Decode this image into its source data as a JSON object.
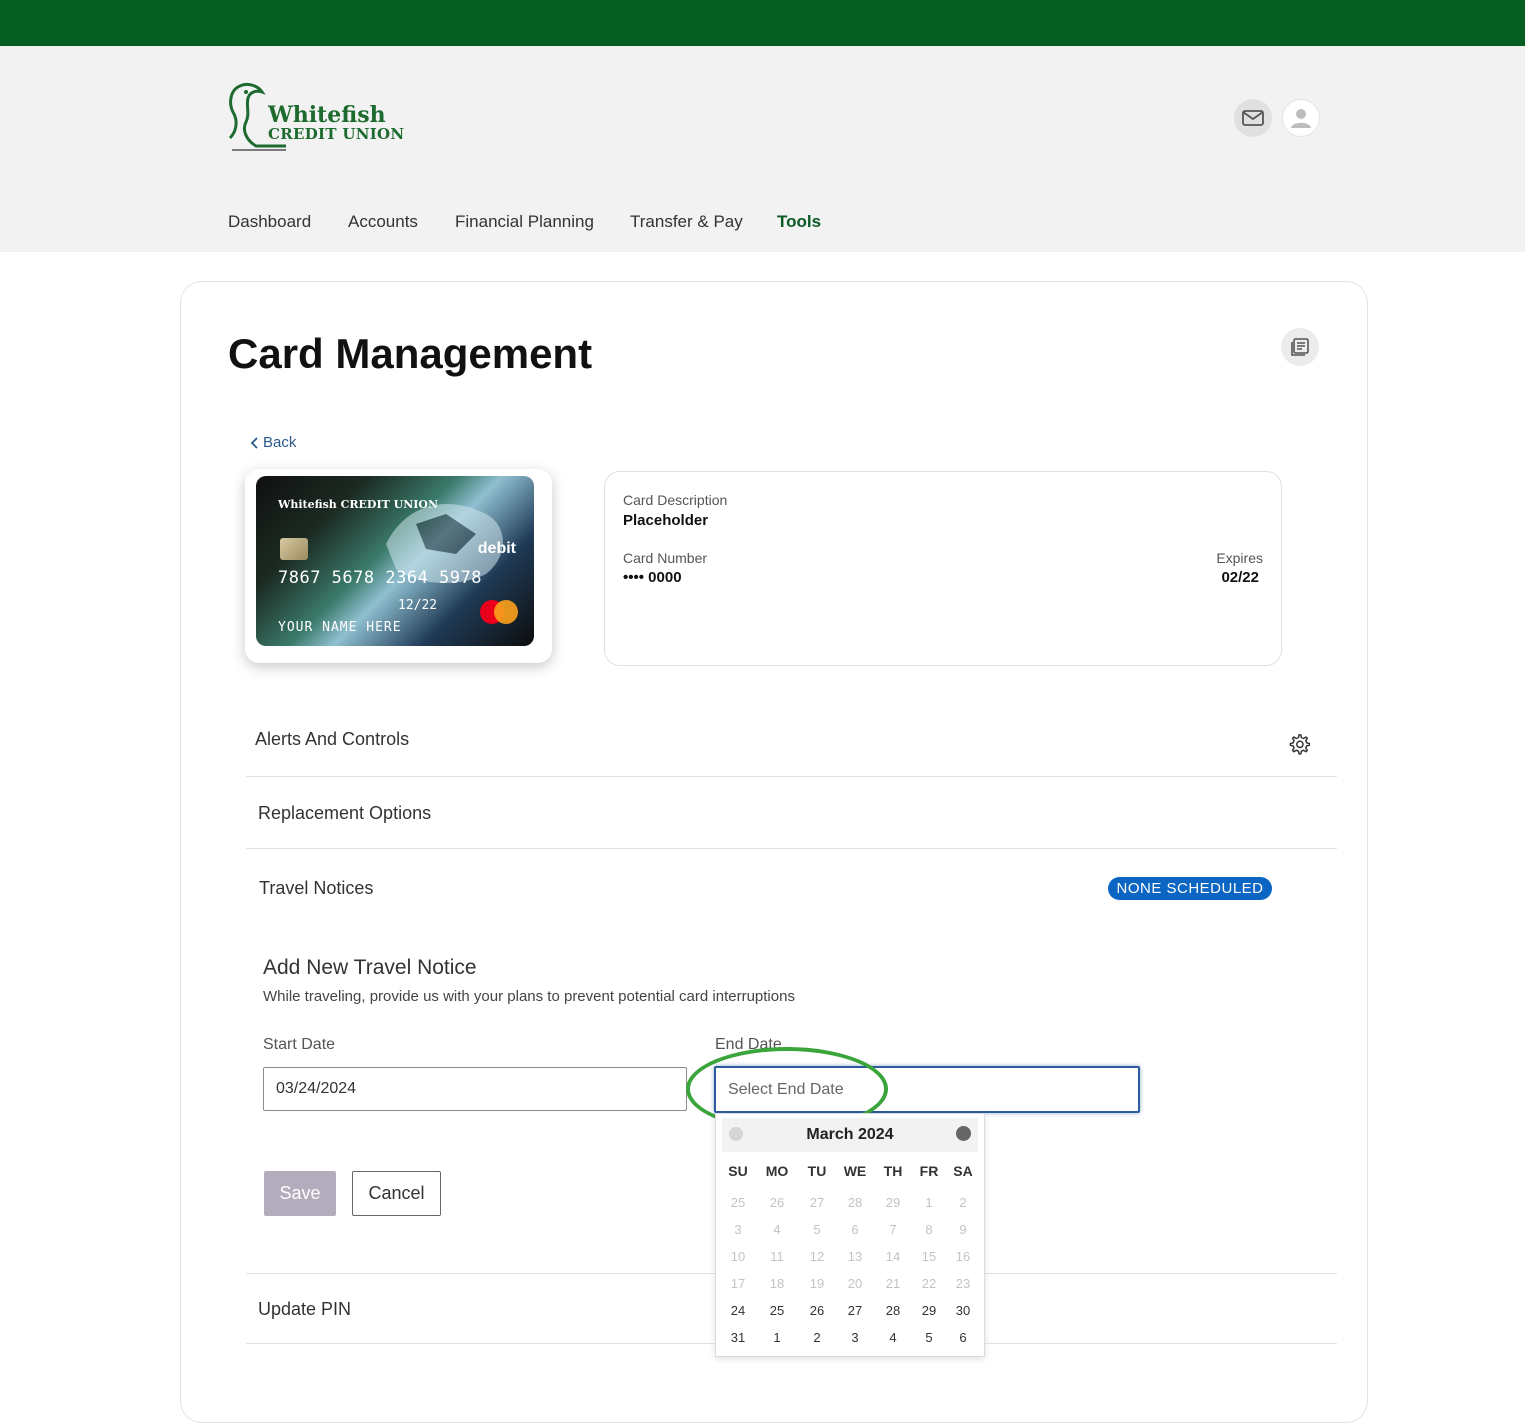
{
  "brand": {
    "line1": "Whitefish",
    "line2": "CREDIT UNION"
  },
  "nav": [
    "Dashboard",
    "Accounts",
    "Financial Planning",
    "Transfer & Pay",
    "Tools"
  ],
  "nav_active": "Tools",
  "page_title": "Card Management",
  "back_label": "Back",
  "card_image": {
    "brand": "Whitefish CREDIT UNION",
    "type": "debit",
    "number": "7867 5678 2364 5978",
    "expiry": "12/22",
    "name": "YOUR NAME HERE",
    "network": "mastercard"
  },
  "card_info": {
    "description_label": "Card Description",
    "description_value": "Placeholder",
    "number_label": "Card Number",
    "number_value": "•••• 0000",
    "expires_label": "Expires",
    "expires_value": "02/22"
  },
  "sections": {
    "alerts": "Alerts And Controls",
    "replacement": "Replacement Options",
    "travel": "Travel Notices",
    "travel_badge": "NONE  SCHEDULED",
    "update_pin": "Update PIN"
  },
  "travel_form": {
    "title": "Add New Travel Notice",
    "subtitle": "While traveling, provide us with your plans to prevent potential card interruptions",
    "start_label": "Start Date",
    "start_value": "03/24/2024",
    "end_label": "End Date",
    "end_placeholder": "Select End Date",
    "save": "Save",
    "cancel": "Cancel"
  },
  "calendar": {
    "month": "March 2024",
    "dow": [
      "SU",
      "MO",
      "TU",
      "WE",
      "TH",
      "FR",
      "SA"
    ],
    "weeks": [
      [
        25,
        26,
        27,
        28,
        29,
        1,
        2
      ],
      [
        3,
        4,
        5,
        6,
        7,
        8,
        9
      ],
      [
        10,
        11,
        12,
        13,
        14,
        15,
        16
      ],
      [
        17,
        18,
        19,
        20,
        21,
        22,
        23
      ],
      [
        24,
        25,
        26,
        27,
        28,
        29,
        30
      ],
      [
        31,
        1,
        2,
        3,
        4,
        5,
        6
      ]
    ],
    "enabled_weeks": [
      4,
      5
    ]
  },
  "colors": {
    "top_bar": "#075e22",
    "active_nav": "#0b5a25",
    "badge": "#0a66c2",
    "highlight_ring": "#3aa53a",
    "save_disabled": "#b3acbd"
  }
}
